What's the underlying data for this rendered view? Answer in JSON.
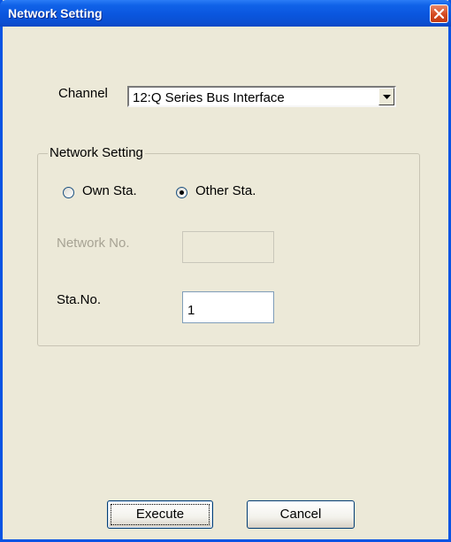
{
  "window": {
    "title": "Network Setting"
  },
  "titlebar": {
    "close_icon": "close-icon"
  },
  "channel": {
    "label": "Channel",
    "value": "12:Q Series Bus Interface",
    "dropdown_icon": "chevron-down-icon"
  },
  "network_group": {
    "title": "Network Setting",
    "own_station": {
      "label": "Own Sta.",
      "selected": false
    },
    "other_station": {
      "label": "Other Sta.",
      "selected": true
    },
    "network_no": {
      "label": "Network No.",
      "value": "",
      "enabled": false
    },
    "station_no": {
      "label": "Sta.No.",
      "value": "1",
      "enabled": true
    }
  },
  "buttons": {
    "execute": "Execute",
    "cancel": "Cancel"
  },
  "colors": {
    "titlebar": "#0a56de",
    "dialog_bg": "#ece9d8",
    "close_button": "#d5491f",
    "disabled_text": "#a7a394"
  }
}
